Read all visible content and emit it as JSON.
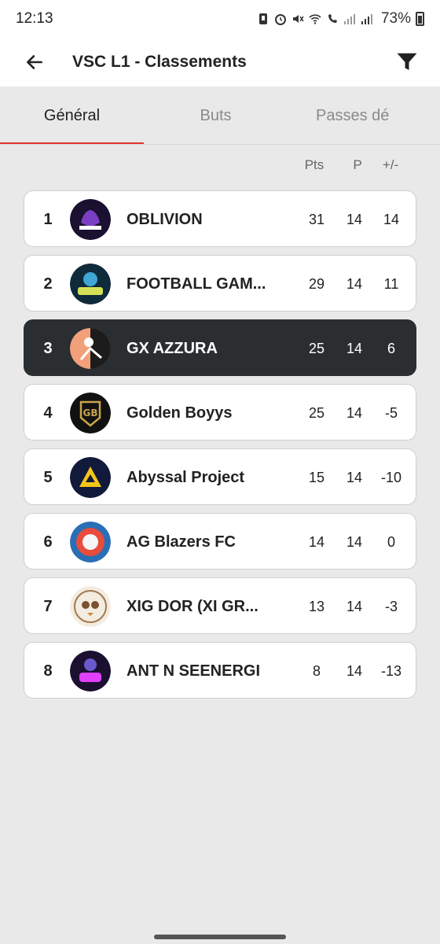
{
  "status_bar": {
    "time": "12:13",
    "battery": "73%",
    "icons": [
      "nfc-icon",
      "alarm-icon",
      "mute-icon",
      "wifi-icon",
      "wifi-calling-icon",
      "signal-icon",
      "signal-icon",
      "battery-icon"
    ]
  },
  "app_bar": {
    "title": "VSC L1 - Classements",
    "back_icon": "arrow-left-icon",
    "filter_icon": "filter-icon"
  },
  "tabs": [
    {
      "label": "Général",
      "active": true
    },
    {
      "label": "Buts",
      "active": false
    },
    {
      "label": "Passes dé",
      "active": false
    }
  ],
  "columns": {
    "pts": "Pts",
    "p": "P",
    "gd": "+/-"
  },
  "standings": [
    {
      "rank": "1",
      "team": "OBLIVION",
      "pts": "31",
      "p": "14",
      "gd": "14",
      "highlight": false
    },
    {
      "rank": "2",
      "team": "FOOTBALL GAM...",
      "pts": "29",
      "p": "14",
      "gd": "11",
      "highlight": false
    },
    {
      "rank": "3",
      "team": "GX AZZURA",
      "pts": "25",
      "p": "14",
      "gd": "6",
      "highlight": true
    },
    {
      "rank": "4",
      "team": "Golden Boyys",
      "pts": "25",
      "p": "14",
      "gd": "-5",
      "highlight": false
    },
    {
      "rank": "5",
      "team": "Abyssal Project",
      "pts": "15",
      "p": "14",
      "gd": "-10",
      "highlight": false
    },
    {
      "rank": "6",
      "team": "AG Blazers FC",
      "pts": "14",
      "p": "14",
      "gd": "0",
      "highlight": false
    },
    {
      "rank": "7",
      "team": "XIG DOR (XI GR...",
      "pts": "13",
      "p": "14",
      "gd": "-3",
      "highlight": false
    },
    {
      "rank": "8",
      "team": "ANT N SEENERGI",
      "pts": "8",
      "p": "14",
      "gd": "-13",
      "highlight": false
    }
  ],
  "colors": {
    "accent": "#e0342c",
    "highlight_row": "#2b2e31",
    "background": "#e9e9e9"
  }
}
